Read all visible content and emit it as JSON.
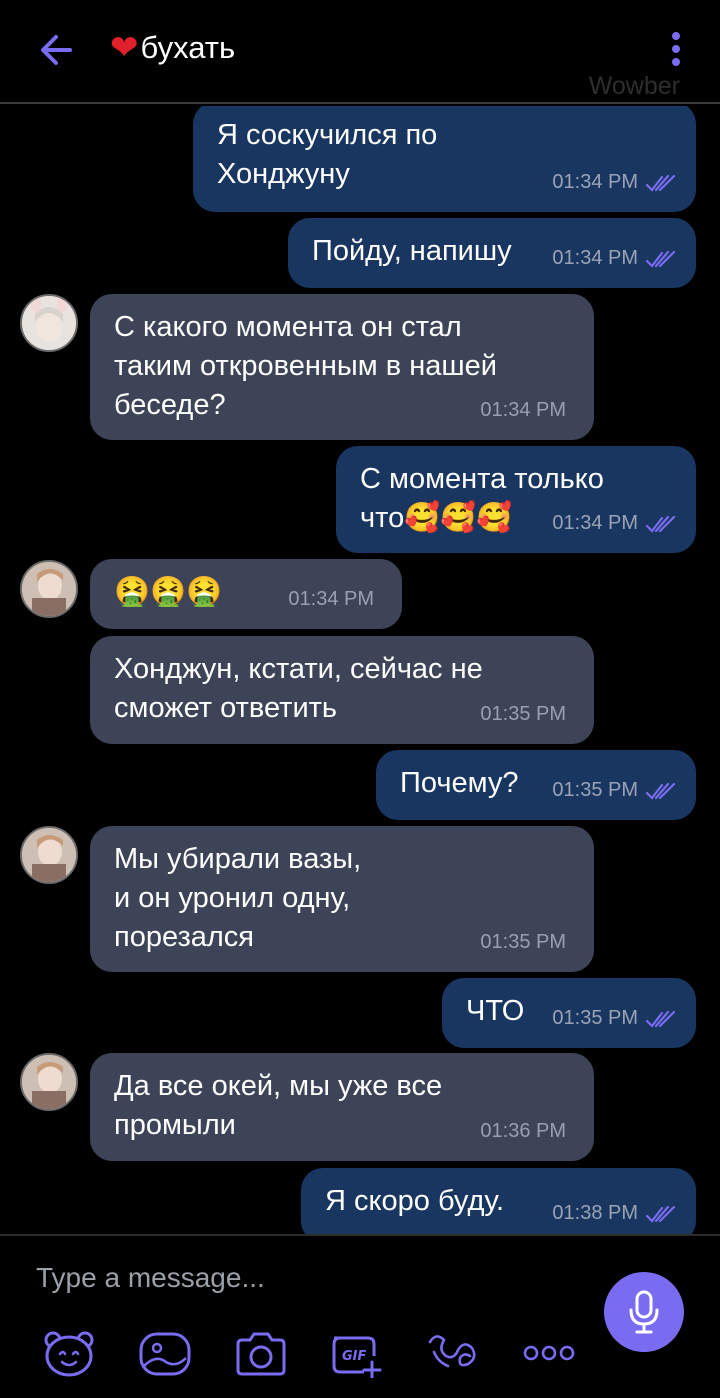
{
  "header": {
    "title": "бухать",
    "watermark": "Wowber"
  },
  "messages": [
    {
      "side": "out",
      "text": "Я соскучился по\nХонджуну",
      "time": "01:34 PM"
    },
    {
      "side": "out",
      "text": "Пойду, напишу",
      "time": "01:34 PM"
    },
    {
      "side": "in",
      "text": "С какого момента он стал\nтаким откровенным в нашей\nбеседе?",
      "time": "01:34 PM"
    },
    {
      "side": "out",
      "text": "С момента только\nчто🥰🥰🥰",
      "time": "01:34 PM"
    },
    {
      "side": "in",
      "text": "🤮🤮🤮",
      "time": "01:34 PM"
    },
    {
      "side": "in",
      "text": "Хонджун, кстати, сейчас не\nсможет ответить",
      "time": "01:35 PM"
    },
    {
      "side": "out",
      "text": "Почему?",
      "time": "01:35 PM"
    },
    {
      "side": "in",
      "text": "Мы убирали вазы,\nи он уронил одну,\nпорезался",
      "time": "01:35 PM"
    },
    {
      "side": "out",
      "text": "ЧТО",
      "time": "01:35 PM"
    },
    {
      "side": "in",
      "text": "Да все окей, мы уже все\nпромыли",
      "time": "01:36 PM"
    },
    {
      "side": "out",
      "text": "Я скоро буду.",
      "time": "01:38 PM"
    }
  ],
  "composer": {
    "placeholder": "Type a message..."
  },
  "colors": {
    "accent": "#7a6cf0",
    "outgoing_bubble": "#183660",
    "incoming_bubble": "#3d4457"
  },
  "icons": [
    "back-arrow-icon",
    "heart-icon",
    "more-vert-icon",
    "double-check-icon",
    "sticker-icon",
    "gallery-icon",
    "camera-icon",
    "gif-icon",
    "doodle-icon",
    "more-horiz-icon",
    "mic-icon"
  ]
}
